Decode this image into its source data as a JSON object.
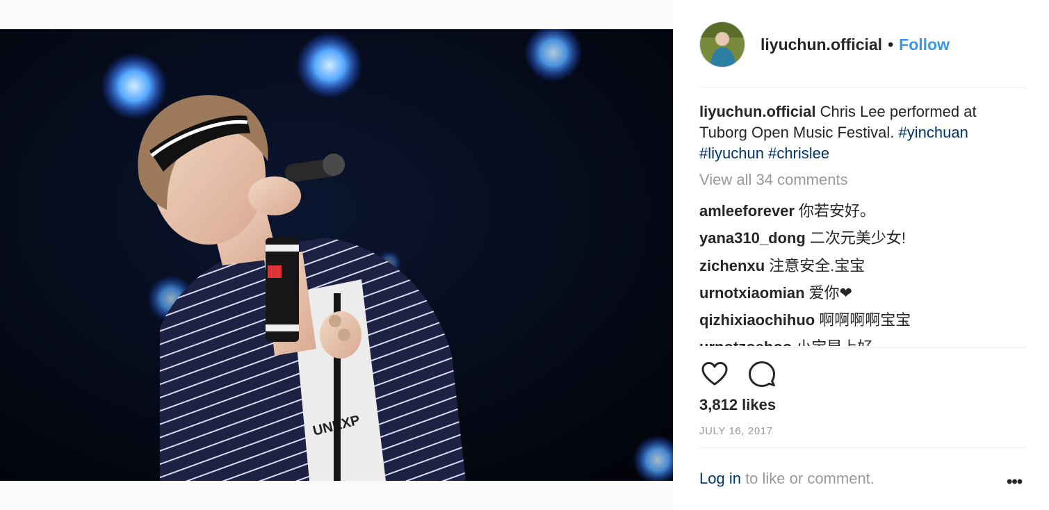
{
  "post": {
    "username": "liyuchun.official",
    "separator": "•",
    "follow_label": "Follow",
    "caption_text": " Chris Lee performed at Tuborg Open Music Festival. ",
    "hashtags": [
      "#yinchuan",
      "#liyuchun",
      "#chrislee"
    ],
    "view_all_comments": "View all 34 comments",
    "likes": "3,812 likes",
    "date": "JULY 16, 2017",
    "login_link": "Log in",
    "login_rest": " to like or comment.",
    "more_label": "•••"
  },
  "comments": [
    {
      "user": "amleeforever",
      "text": "你若安好。"
    },
    {
      "user": "yana310_dong",
      "text": "二次元美少女!"
    },
    {
      "user": "zichenxu",
      "text": "注意安全.宝宝"
    },
    {
      "user": "urnotxiaomian",
      "text": "爱你❤"
    },
    {
      "user": "qizhixiaochihuo",
      "text": "啊啊啊啊宝宝"
    },
    {
      "user": "urnotzoehoo",
      "text": "小宝早上好"
    }
  ],
  "icons": {
    "like": "heart-icon",
    "comment": "speech-bubble-icon",
    "more": "ellipsis-icon"
  },
  "colors": {
    "link_blue": "#3897f0",
    "hashtag_navy": "#003569",
    "muted_gray": "#999999",
    "text": "#262626"
  }
}
